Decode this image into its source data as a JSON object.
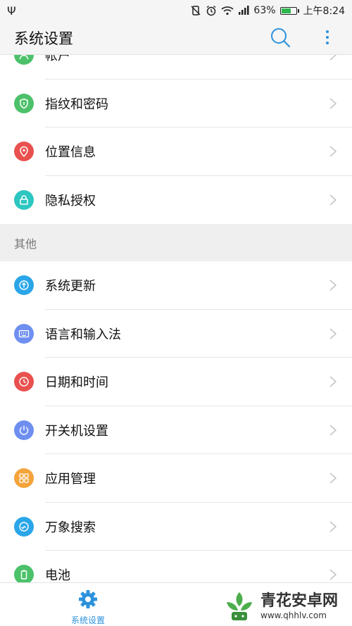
{
  "status_bar": {
    "battery": "63%",
    "time": "上午8:24",
    "battery_level": 0.63
  },
  "header": {
    "title": "系统设置"
  },
  "list": {
    "items": [
      {
        "label": "帐户",
        "icon": "account-icon",
        "color": "#4cc16a"
      },
      {
        "label": "指纹和密码",
        "icon": "shield-icon",
        "color": "#4cc16a"
      },
      {
        "label": "位置信息",
        "icon": "location-icon",
        "color": "#e9514f"
      },
      {
        "label": "隐私授权",
        "icon": "lock-icon",
        "color": "#2ec6c0"
      }
    ],
    "section_other": "其他",
    "other_items": [
      {
        "label": "系统更新",
        "icon": "update-icon",
        "color": "#2aa6e8"
      },
      {
        "label": "语言和输入法",
        "icon": "keyboard-icon",
        "color": "#6e8ff0"
      },
      {
        "label": "日期和时间",
        "icon": "clock-icon",
        "color": "#e9514f"
      },
      {
        "label": "开关机设置",
        "icon": "power-icon",
        "color": "#6e8ff0"
      },
      {
        "label": "应用管理",
        "icon": "apps-icon",
        "color": "#f4a43a"
      },
      {
        "label": "万象搜索",
        "icon": "search-circle-icon",
        "color": "#2aa6e8"
      },
      {
        "label": "电池",
        "icon": "battery-icon",
        "color": "#4cc16a"
      }
    ]
  },
  "bottom_nav": {
    "settings_label": "系统设置"
  },
  "watermark": {
    "name": "青花安卓网",
    "url": "www.qhhlv.com"
  },
  "colors": {
    "accent": "#2d92dd"
  }
}
